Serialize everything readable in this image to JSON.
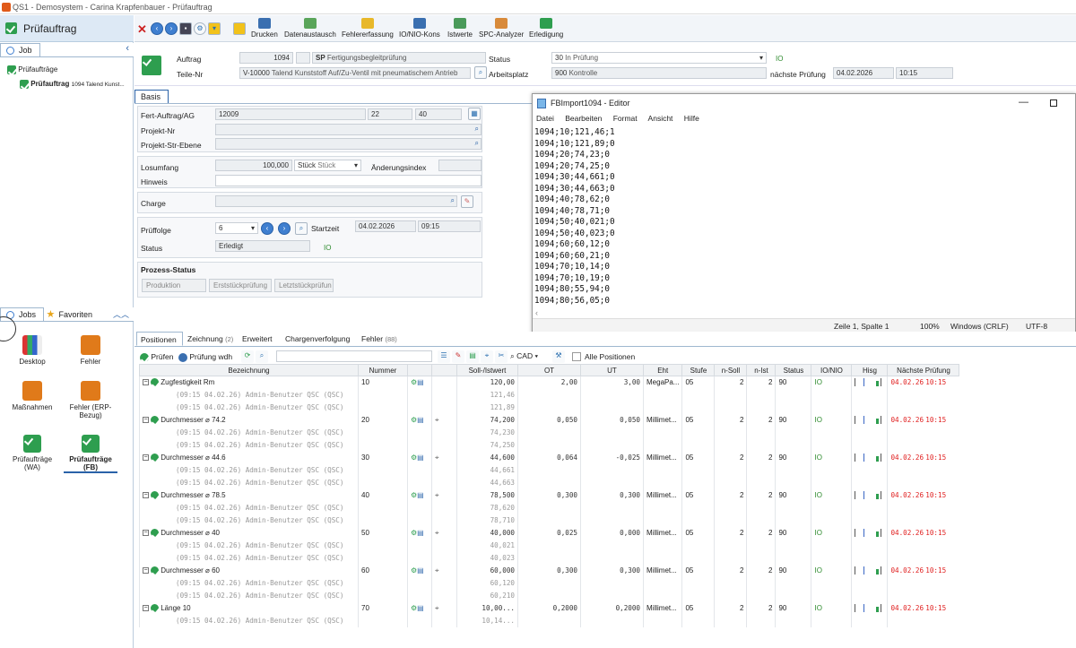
{
  "window": {
    "title": "QS1 - Demosystem - Carina Krapfenbauer - Prüfauftrag"
  },
  "sidebar": {
    "title": "Prüfauftrag",
    "top_tab": "Job",
    "tree": [
      {
        "label": "Prüfaufträge"
      },
      {
        "label": "Prüfauftrag",
        "detail": "1094 Talend Kunst..."
      }
    ],
    "bottom_tabs": [
      "Jobs",
      "Favoriten"
    ],
    "tiles": [
      {
        "label": "Desktop"
      },
      {
        "label": "Fehler"
      },
      {
        "label": "Maßnahmen"
      },
      {
        "label": "Fehler (ERP-Bezug)"
      },
      {
        "label": "Prüfaufträge (WA)"
      },
      {
        "label": "Prüfaufträge (FB)"
      }
    ]
  },
  "toolbar": {
    "buttons": [
      "Drucken",
      "Datenaustausch",
      "Fehlererfassung",
      "IO/NIO-Kons",
      "Istwerte",
      "SPC-Analyzer",
      "Erledigung"
    ]
  },
  "header": {
    "auftrag_label": "Auftrag",
    "auftrag_value": "1094",
    "auftrag_type": "SP",
    "auftrag_type_text": "Fertigungsbegleitprüfung",
    "teile_label": "Teile-Nr",
    "teile_value": "V-10000",
    "teile_text": "Talend Kunststoff Auf/Zu-Ventil mit pneumatischem Antrieb",
    "status_label": "Status",
    "status_code": "30",
    "status_text": "In Prüfung",
    "status_io": "IO",
    "arbeitsplatz_label": "Arbeitsplatz",
    "arbeitsplatz_code": "900",
    "arbeitsplatz_text": "Kontrolle",
    "naechste_label": "nächste Prüfung",
    "naechste_date": "04.02.2026",
    "naechste_time": "10:15"
  },
  "basis": {
    "tab": "Basis",
    "fert_label": "Fert-Auftrag/AG",
    "fert_value": "12009",
    "fert_v2": "22",
    "fert_v3": "40",
    "projekt_label": "Projekt-Nr",
    "projekt_str_label": "Projekt-Str-Ebene",
    "losumfang_label": "Losumfang",
    "losumfang_value": "100,000",
    "stueck1": "Stück",
    "stueck2": "Stück",
    "aenderung_label": "Änderungsindex",
    "hinweis_label": "Hinweis",
    "charge_label": "Charge",
    "prueffolge_label": "Prüffolge",
    "prueffolge_value": "6",
    "startzeit_label": "Startzeit",
    "start_date": "04.02.2026",
    "start_time": "09:15",
    "status_label": "Status",
    "status_value": "Erledigt",
    "status_io": "IO",
    "prozess_label": "Prozess-Status",
    "prozess_buttons": [
      "Produktion",
      "Erststückprüfung",
      "Letztstückprüfun"
    ]
  },
  "notepad": {
    "title": "FBImport1094 - Editor",
    "menu": [
      "Datei",
      "Bearbeiten",
      "Format",
      "Ansicht",
      "Hilfe"
    ],
    "lines": "1094;10;121,46;1\n1094;10;121,89;0\n1094;20;74,23;0\n1094;20;74,25;0\n1094;30;44,661;0\n1094;30;44,663;0\n1094;40;78,62;0\n1094;40;78,71;0\n1094;50;40,021;0\n1094;50;40,023;0\n1094;60;60,12;0\n1094;60;60,21;0\n1094;70;10,14;0\n1094;70;10,19;0\n1094;80;55,94;0\n1094;80;56,05;0",
    "status_pos": "Zeile 1, Spalte 1",
    "status_zoom": "100%",
    "status_eol": "Windows (CRLF)",
    "status_enc": "UTF-8"
  },
  "positions": {
    "tabs": [
      "Positionen",
      "Zeichnung",
      "Erweitert",
      "Chargenverfolgung",
      "Fehler"
    ],
    "tab_counts": {
      "Zeichnung": "(2)",
      "Fehler": "(88)"
    },
    "toolbar": {
      "pruefen": "Prüfen",
      "pruefung_wdh": "Prüfung wdh",
      "cad": "CAD",
      "alle": "Alle Positionen"
    },
    "columns": [
      "Bezeichnung",
      "Nummer",
      "",
      "",
      "Soll-/Istwert",
      "OT",
      "UT",
      "Eht",
      "Stufe",
      "n-Soll",
      "n-Ist",
      "Status",
      "IO/NIO",
      "Hisg",
      "Nächste Prüfung"
    ],
    "rows": [
      {
        "name": "Zugfestigkeit Rm",
        "num": "10",
        "soll": "120,00",
        "ot": "2,00",
        "ut": "3,00",
        "eht": "MegaPa...",
        "stufe": "05",
        "nsoll": "2",
        "nist": "2",
        "status": "90",
        "io": "IO",
        "next_date": "04.02.26",
        "next_time": "10:15",
        "subs": [
          {
            "text": "(09:15 04.02.26) Admin-Benutzer QSC (QSC)",
            "val": "121,46"
          },
          {
            "text": "(09:15 04.02.26) Admin-Benutzer QSC (QSC)",
            "val": "121,89"
          }
        ]
      },
      {
        "name": "Durchmesser ⌀ 74.2",
        "num": "20",
        "soll": "74,200",
        "ot": "0,050",
        "ut": "0,050",
        "eht": "Millimet...",
        "stufe": "05",
        "nsoll": "2",
        "nist": "2",
        "status": "90",
        "io": "IO",
        "next_date": "04.02.26",
        "next_time": "10:15",
        "subs": [
          {
            "text": "(09:15 04.02.26) Admin-Benutzer QSC (QSC)",
            "val": "74,230"
          },
          {
            "text": "(09:15 04.02.26) Admin-Benutzer QSC (QSC)",
            "val": "74,250"
          }
        ]
      },
      {
        "name": "Durchmesser ⌀ 44.6",
        "num": "30",
        "soll": "44,600",
        "ot": "0,064",
        "ut": "-0,025",
        "eht": "Millimet...",
        "stufe": "05",
        "nsoll": "2",
        "nist": "2",
        "status": "90",
        "io": "IO",
        "next_date": "04.02.26",
        "next_time": "10:15",
        "subs": [
          {
            "text": "(09:15 04.02.26) Admin-Benutzer QSC (QSC)",
            "val": "44,661"
          },
          {
            "text": "(09:15 04.02.26) Admin-Benutzer QSC (QSC)",
            "val": "44,663"
          }
        ]
      },
      {
        "name": "Durchmesser ⌀ 78.5",
        "num": "40",
        "soll": "78,500",
        "ot": "0,300",
        "ut": "0,300",
        "eht": "Millimet...",
        "stufe": "05",
        "nsoll": "2",
        "nist": "2",
        "status": "90",
        "io": "IO",
        "next_date": "04.02.26",
        "next_time": "10:15",
        "subs": [
          {
            "text": "(09:15 04.02.26) Admin-Benutzer QSC (QSC)",
            "val": "78,620"
          },
          {
            "text": "(09:15 04.02.26) Admin-Benutzer QSC (QSC)",
            "val": "78,710"
          }
        ]
      },
      {
        "name": "Durchmesser ⌀ 40",
        "num": "50",
        "soll": "40,000",
        "ot": "0,025",
        "ut": "0,000",
        "eht": "Millimet...",
        "stufe": "05",
        "nsoll": "2",
        "nist": "2",
        "status": "90",
        "io": "IO",
        "next_date": "04.02.26",
        "next_time": "10:15",
        "subs": [
          {
            "text": "(09:15 04.02.26) Admin-Benutzer QSC (QSC)",
            "val": "40,021"
          },
          {
            "text": "(09:15 04.02.26) Admin-Benutzer QSC (QSC)",
            "val": "40,023"
          }
        ]
      },
      {
        "name": "Durchmesser ⌀ 60",
        "num": "60",
        "soll": "60,000",
        "ot": "0,300",
        "ut": "0,300",
        "eht": "Millimet...",
        "stufe": "05",
        "nsoll": "2",
        "nist": "2",
        "status": "90",
        "io": "IO",
        "next_date": "04.02.26",
        "next_time": "10:15",
        "subs": [
          {
            "text": "(09:15 04.02.26) Admin-Benutzer QSC (QSC)",
            "val": "60,120"
          },
          {
            "text": "(09:15 04.02.26) Admin-Benutzer QSC (QSC)",
            "val": "60,210"
          }
        ]
      },
      {
        "name": "Länge 10",
        "num": "70",
        "soll": "10,00...",
        "ot": "0,2000",
        "ut": "0,2000",
        "eht": "Millimet...",
        "stufe": "05",
        "nsoll": "2",
        "nist": "2",
        "status": "90",
        "io": "IO",
        "next_date": "04.02.26",
        "next_time": "10:15",
        "subs": [
          {
            "text": "(09:15 04.02.26) Admin-Benutzer QSC (QSC)",
            "val": "10,14..."
          }
        ]
      }
    ]
  },
  "colors": {
    "io_green": "#2e8b2e",
    "next_red": "#e02020",
    "accent": "#dde9f5"
  }
}
